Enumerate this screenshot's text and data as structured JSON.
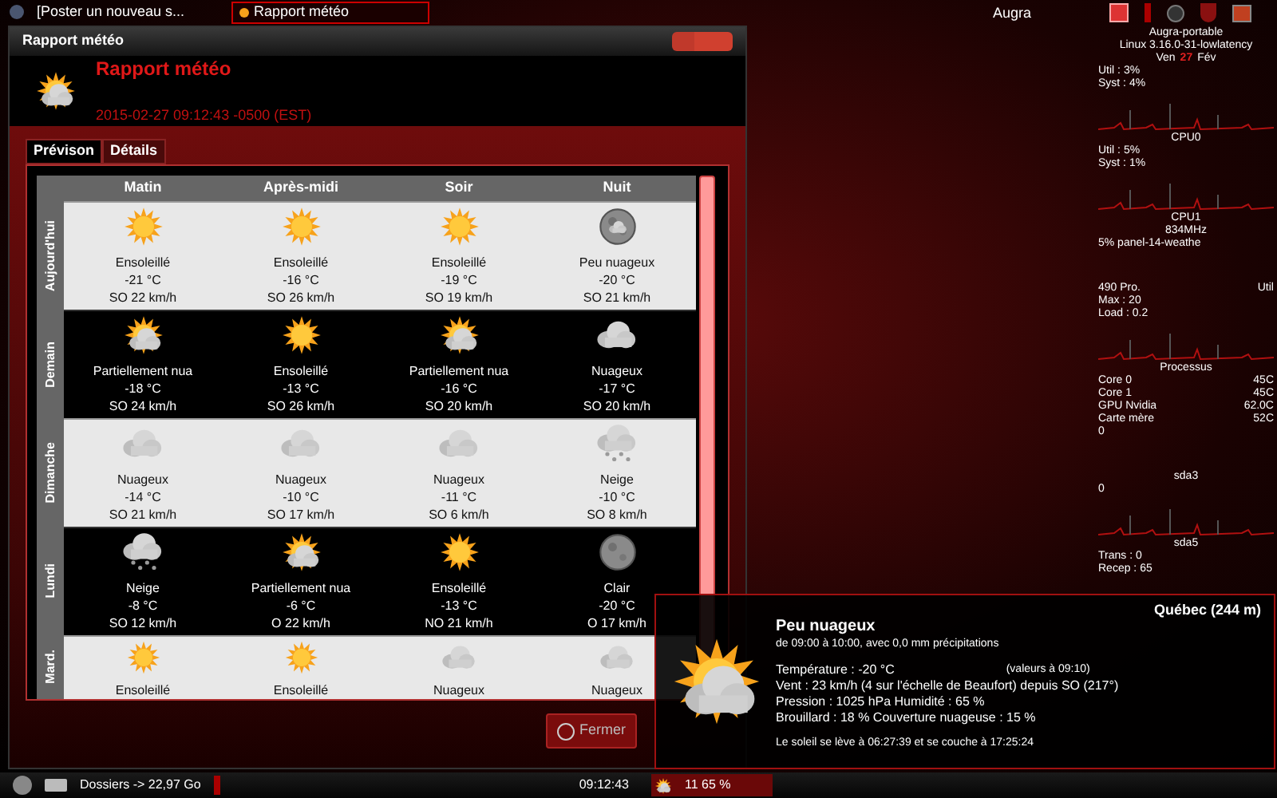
{
  "taskbar_top": {
    "tasks": [
      {
        "label": "[Poster un nouveau s...",
        "selected": false
      },
      {
        "label": "Rapport météo",
        "selected": true
      }
    ],
    "user": "Augra"
  },
  "window": {
    "title": "Rapport météo",
    "heading": "Rapport météo",
    "timestamp": "2015-02-27 09:12:43 -0500 (EST)",
    "tabs": [
      {
        "label": "Prévison",
        "selected": true
      },
      {
        "label": "Détails",
        "selected": false
      }
    ],
    "forecast": {
      "columns": [
        "Matin",
        "Après-midi",
        "Soir",
        "Nuit"
      ],
      "rows": [
        {
          "day": "Aujourd'hui",
          "cells": [
            {
              "kind": "sunny",
              "condition": "Ensoleillé",
              "temp": "-21 °C",
              "wind": "SO 22 km/h"
            },
            {
              "kind": "sunny",
              "condition": "Ensoleillé",
              "temp": "-16 °C",
              "wind": "SO 26 km/h"
            },
            {
              "kind": "sunny",
              "condition": "Ensoleillé",
              "temp": "-19 °C",
              "wind": "SO 19 km/h"
            },
            {
              "kind": "moon-cloud",
              "condition": "Peu nuageux",
              "temp": "-20 °C",
              "wind": "SO 21 km/h"
            }
          ]
        },
        {
          "day": "Demain",
          "cells": [
            {
              "kind": "partly",
              "condition": "Partiellement nua",
              "temp": "-18 °C",
              "wind": "SO 24 km/h"
            },
            {
              "kind": "sunny",
              "condition": "Ensoleillé",
              "temp": "-13 °C",
              "wind": "SO 26 km/h"
            },
            {
              "kind": "partly",
              "condition": "Partiellement nua",
              "temp": "-16 °C",
              "wind": "SO 20 km/h"
            },
            {
              "kind": "cloudy",
              "condition": "Nuageux",
              "temp": "-17 °C",
              "wind": "SO 20 km/h"
            }
          ]
        },
        {
          "day": "Dimanche",
          "cells": [
            {
              "kind": "cloudy",
              "condition": "Nuageux",
              "temp": "-14 °C",
              "wind": "SO 21 km/h"
            },
            {
              "kind": "cloudy",
              "condition": "Nuageux",
              "temp": "-10 °C",
              "wind": "SO 17 km/h"
            },
            {
              "kind": "cloudy",
              "condition": "Nuageux",
              "temp": "-11 °C",
              "wind": "SO 6 km/h"
            },
            {
              "kind": "snow",
              "condition": "Neige",
              "temp": "-10 °C",
              "wind": "SO 8 km/h"
            }
          ]
        },
        {
          "day": "Lundi",
          "cells": [
            {
              "kind": "snow",
              "condition": "Neige",
              "temp": "-8 °C",
              "wind": "SO 12 km/h"
            },
            {
              "kind": "partly",
              "condition": "Partiellement nua",
              "temp": "-6 °C",
              "wind": "O 22 km/h"
            },
            {
              "kind": "sunny",
              "condition": "Ensoleillé",
              "temp": "-13 °C",
              "wind": "NO 21 km/h"
            },
            {
              "kind": "moon",
              "condition": "Clair",
              "temp": "-20 °C",
              "wind": "O 17 km/h"
            }
          ]
        },
        {
          "day": "Mard.",
          "cells": [
            {
              "kind": "sunny",
              "condition": "Ensoleillé"
            },
            {
              "kind": "sunny",
              "condition": "Ensoleillé"
            },
            {
              "kind": "cloudy",
              "condition": "Nuageux"
            },
            {
              "kind": "cloudy",
              "condition": "Nuageux"
            }
          ]
        }
      ]
    },
    "close_button": "Fermer"
  },
  "monitor": [
    {
      "kind": "center",
      "text": "Augra-portable"
    },
    {
      "kind": "center",
      "text": "Linux 3.16.0-31-lowlatency"
    },
    {
      "kind": "date",
      "text": "Ven",
      "day": "27",
      "month": "Fév"
    },
    {
      "kind": "line",
      "text": "Util : 3%"
    },
    {
      "kind": "line",
      "text": "Syst : 4%"
    },
    {
      "kind": "graph"
    },
    {
      "kind": "center",
      "text": "CPU0"
    },
    {
      "kind": "line",
      "text": "Util : 5%"
    },
    {
      "kind": "line",
      "text": "Syst : 1%"
    },
    {
      "kind": "graph"
    },
    {
      "kind": "center",
      "text": "CPU1"
    },
    {
      "kind": "center",
      "text": "834MHz"
    },
    {
      "kind": "line",
      "text": "5% panel-14-weathe"
    },
    {
      "kind": "gap"
    },
    {
      "kind": "pair",
      "label": "490 Pro.",
      "value": "Util"
    },
    {
      "kind": "line",
      "text": "Max : 20"
    },
    {
      "kind": "line",
      "text": "Load : 0.2"
    },
    {
      "kind": "graph"
    },
    {
      "kind": "center",
      "text": "Processus"
    },
    {
      "kind": "pair",
      "label": "Core 0",
      "value": "45C"
    },
    {
      "kind": "pair",
      "label": "Core 1",
      "value": "45C"
    },
    {
      "kind": "pair",
      "label": "GPU Nvidia",
      "value": "62.0C"
    },
    {
      "kind": "pair",
      "label": "Carte mère",
      "value": "52C"
    },
    {
      "kind": "line",
      "text": "0"
    },
    {
      "kind": "gap"
    },
    {
      "kind": "center",
      "text": "sda3"
    },
    {
      "kind": "line",
      "text": "0"
    },
    {
      "kind": "graph"
    },
    {
      "kind": "center",
      "text": "sda5"
    },
    {
      "kind": "line",
      "text": "Trans : 0"
    },
    {
      "kind": "line",
      "text": "Recep : 65"
    }
  ],
  "popup": {
    "location": "Québec (244 m)",
    "condition": "Peu nuageux",
    "period": "de 09:00 à 10:00, avec 0,0 mm précipitations",
    "temperature": "Température : -20 °C",
    "note": "(valeurs à 09:10)",
    "details": [
      "Vent : 23 km/h (4 sur l'échelle de Beaufort) depuis SO (217°)",
      "Pression : 1025 hPa Humidité : 65 %",
      "Brouillard : 18 % Couverture nuageuse : 15 %"
    ],
    "sun": "Le soleil se lève à 06:27:39 et se couche à 17:25:24"
  },
  "taskbar_bottom": {
    "folders": "Dossiers -> 22,97 Go",
    "clock": "09:12:43",
    "weather": "11 65 %"
  }
}
